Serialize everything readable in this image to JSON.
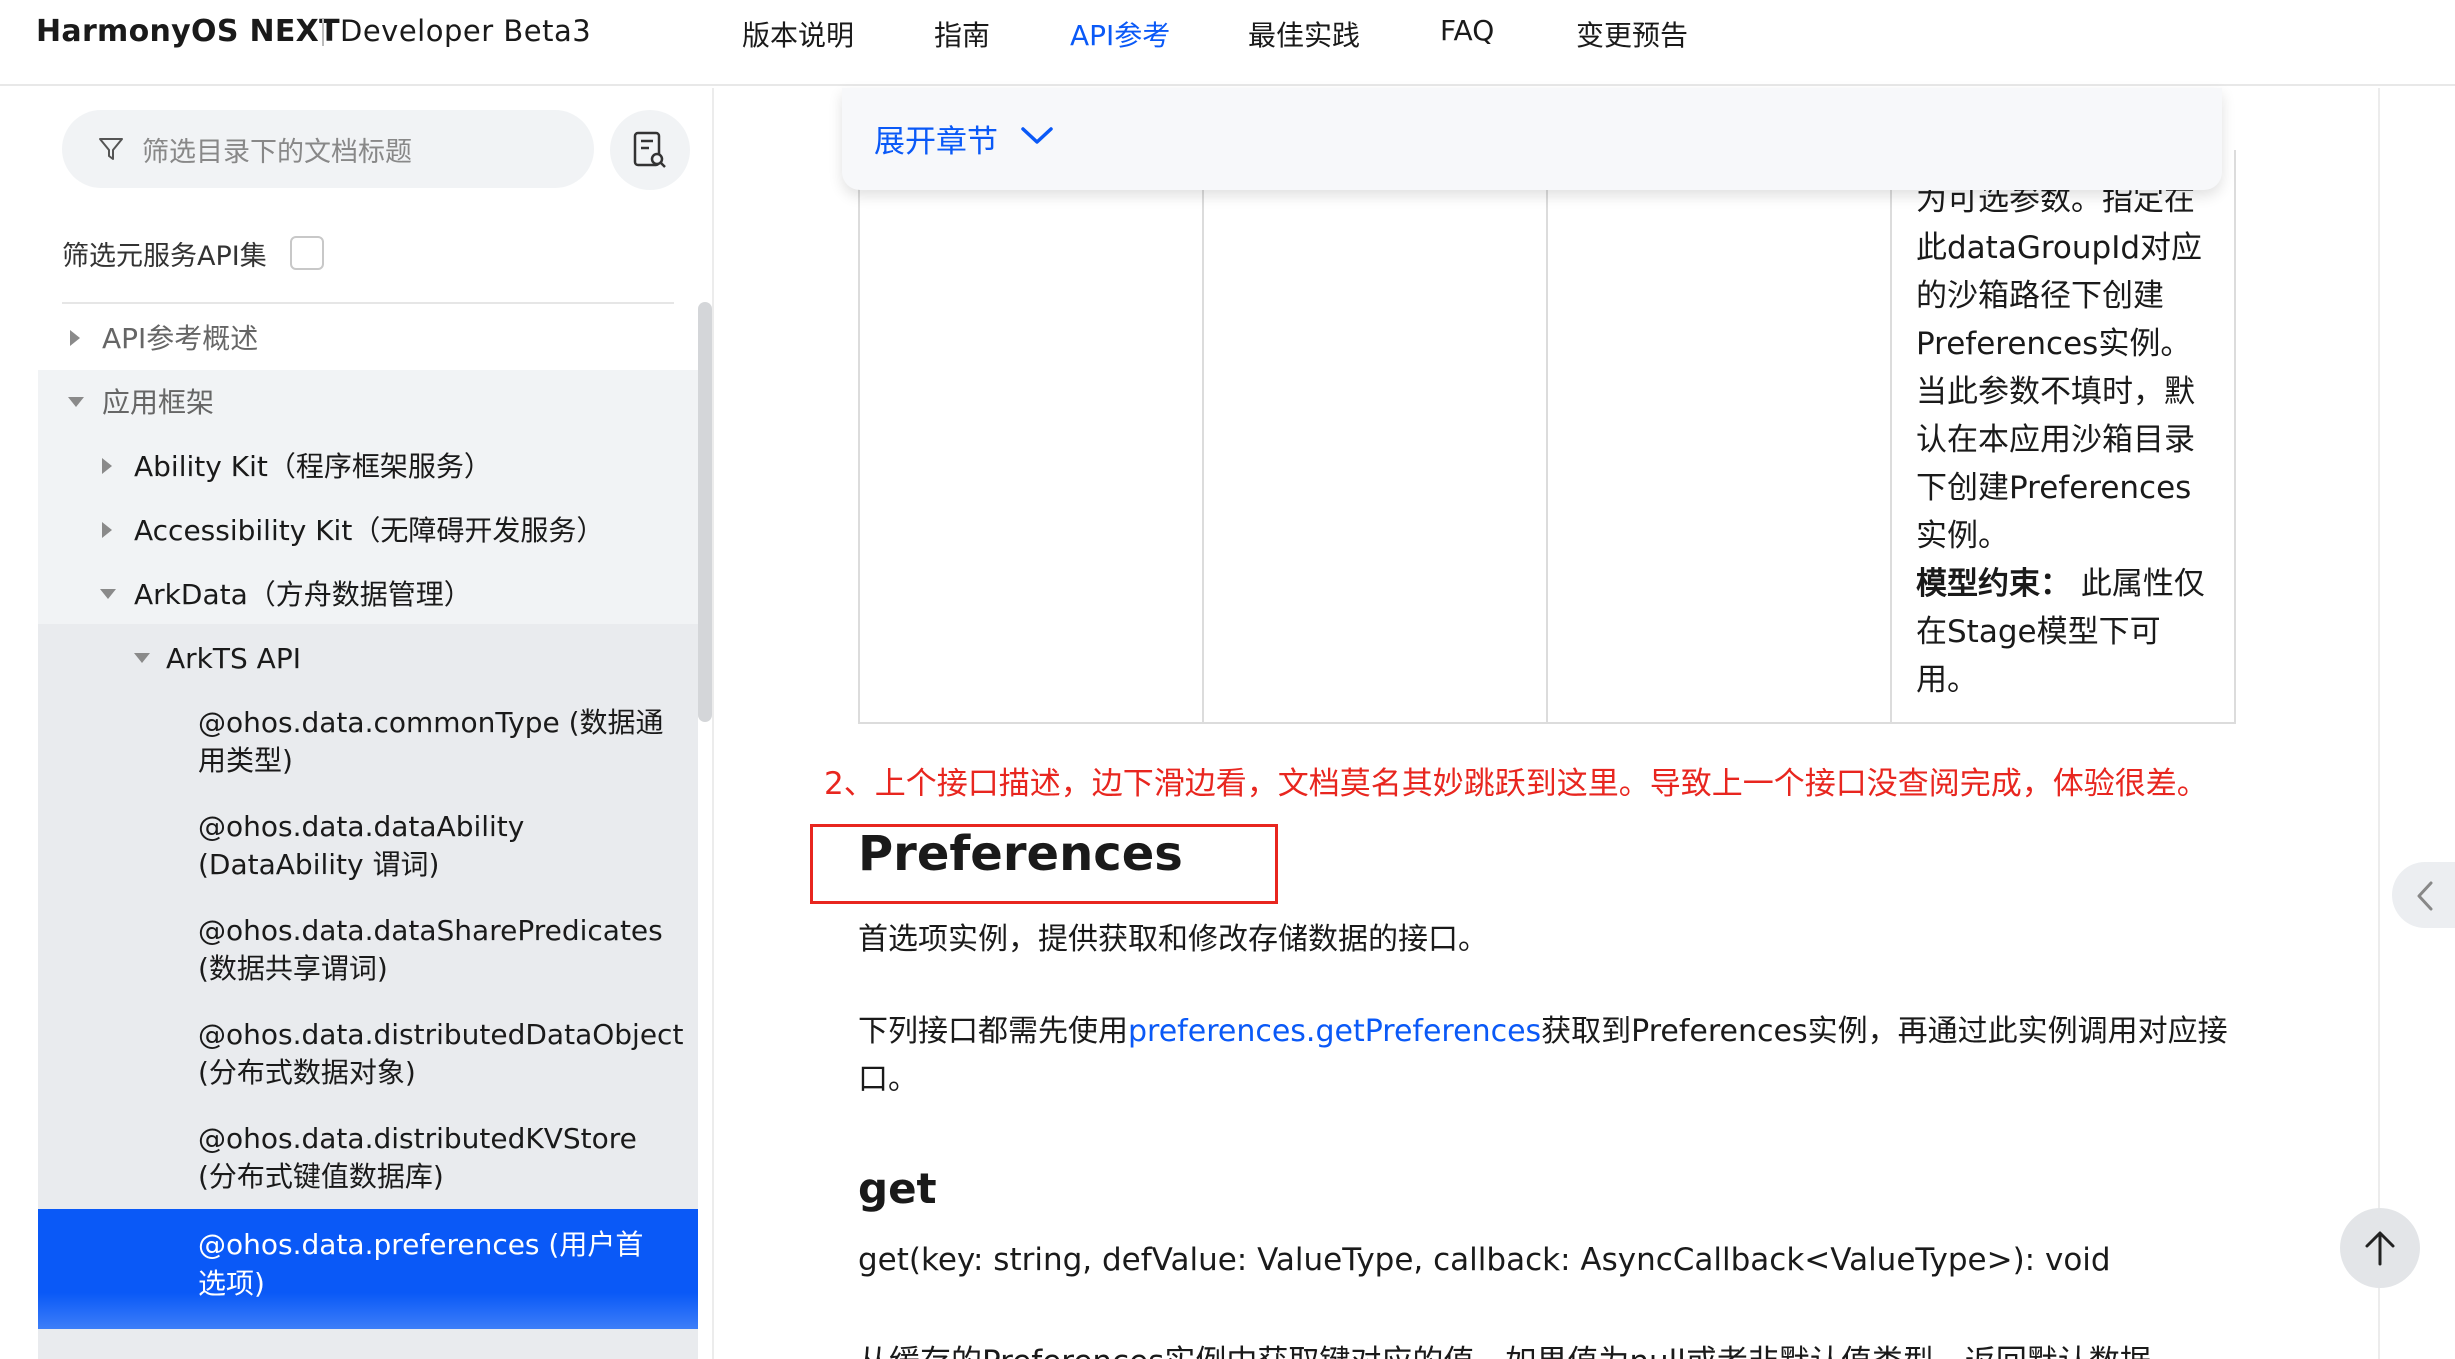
{
  "header": {
    "brand": "HarmonyOS NEXT",
    "subtitle": "Developer Beta3",
    "nav": [
      "版本说明",
      "指南",
      "API参考",
      "最佳实践",
      "FAQ",
      "变更预告"
    ],
    "active_nav": "API参考"
  },
  "sidebar": {
    "filter_placeholder": "筛选目录下的文档标题",
    "atomic_filter_label": "筛选元服务API集",
    "tree": {
      "api_overview": "API参考概述",
      "app_framework": "应用框架",
      "ability_kit": "Ability Kit（程序框架服务）",
      "accessibility_kit": "Accessibility Kit（无障碍开发服务）",
      "arkdata": "ArkData（方舟数据管理）",
      "arkts_api": "ArkTS API",
      "common_type": "@ohos.data.commonType (数据通用类型)",
      "data_ability": "@ohos.data.dataAbility (DataAbility 谓词)",
      "share_predicates": "@ohos.data.dataSharePredicates (数据共享谓词)",
      "distributed_object": "@ohos.data.distributedDataObject (分布式数据对象)",
      "distributed_kv": "@ohos.data.distributedKVStore (分布式键值数据库)",
      "preferences": "@ohos.data.preferences (用户首选项)"
    }
  },
  "content": {
    "expand_label": "展开章节",
    "table_cell_text": "为可选参数。指定在此dataGroupId对应的沙箱路径下创建Preferences实例。当此参数不填时，默认在本应用沙箱目录下创建Preferences实例。",
    "table_cell_bold": "模型约束：",
    "table_cell_tail": " 此属性仅在Stage模型下可用。",
    "annotation": "2、上个接口描述，边下滑边看，文档莫名其妙跳跃到这里。导致上一个接口没查阅完成，体验很差。",
    "heading_preferences": "Preferences",
    "intro": "首选项实例，提供获取和修改存储数据的接口。",
    "usage_prefix": "下列接口都需先使用",
    "usage_link": "preferences.getPreferences",
    "usage_suffix": "获取到Preferences实例，再通过此实例调用对应接口。",
    "heading_get": "get",
    "get_signature": "get(key: string, defValue: ValueType, callback: AsyncCallback<ValueType>): void",
    "get_desc": "从缓存的Preferences实例中获取键对应的值，如果值为null或者非默认值类型，返回默认数据"
  },
  "colors": {
    "accent": "#0a59f7",
    "annotation": "#e8261f"
  }
}
